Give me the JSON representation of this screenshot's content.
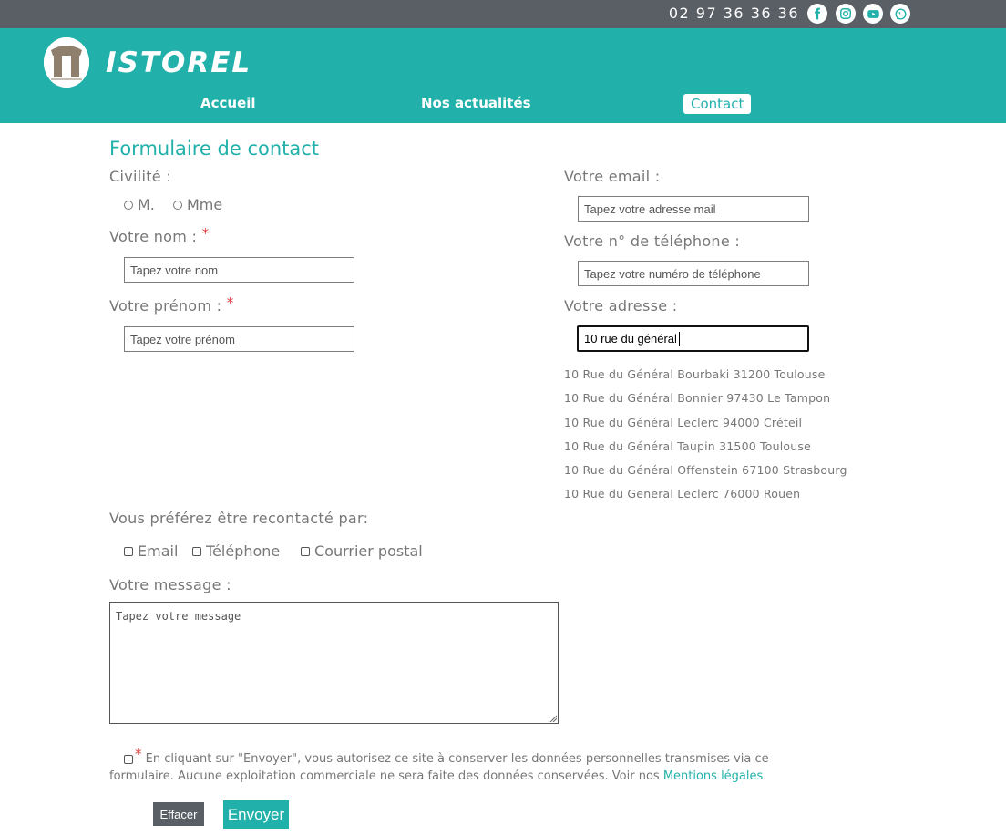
{
  "topbar": {
    "phone": "02 97 36 36 36",
    "social": [
      {
        "icon": "facebook-icon"
      },
      {
        "icon": "instagram-icon"
      },
      {
        "icon": "youtube-icon"
      },
      {
        "icon": "whatsapp-icon"
      }
    ]
  },
  "header": {
    "brand": "ISTOREL",
    "nav": [
      "Accueil",
      "Nos actualités",
      "Contact"
    ],
    "active_nav": "Contact"
  },
  "form": {
    "title": "Formulaire de contact",
    "civility": {
      "label": "Civilité :",
      "options": [
        "M.",
        "Mme"
      ]
    },
    "name": {
      "label": "Votre nom :",
      "required": "*",
      "placeholder": "Tapez votre nom"
    },
    "firstname": {
      "label": "Votre prénom :",
      "required": "*",
      "placeholder": "Tapez votre prénom"
    },
    "email": {
      "label": "Votre email :",
      "placeholder": "Tapez votre adresse mail"
    },
    "phone": {
      "label": "Votre n° de téléphone :",
      "placeholder": "Tapez votre numéro de téléphone"
    },
    "address": {
      "label": "Votre adresse :",
      "value": "10 rue du général",
      "suggestions": [
        "10 Rue du Général Bourbaki 31200 Toulouse",
        "10 Rue du Général Bonnier 97430 Le Tampon",
        "10 Rue du Général Leclerc 94000 Créteil",
        "10 Rue du Général Taupin 31500 Toulouse",
        "10 Rue du Général Offenstein 67100 Strasbourg",
        "10 Rue du General Leclerc 76000 Rouen"
      ]
    },
    "contact_pref": {
      "label": "Vous préférez être recontacté par:",
      "options": [
        "Email",
        "Téléphone",
        "Courrier postal"
      ]
    },
    "message": {
      "label": "Votre message :",
      "placeholder": "Tapez votre message"
    },
    "consent": {
      "required": "*",
      "text": "En cliquant sur \"Envoyer\", vous autorisez ce site à conserver les données personnelles transmises via ce formulaire. Aucune exploitation commerciale ne sera faite des données conservées. Voir nos ",
      "link": "Mentions légales",
      "end": "."
    },
    "buttons": {
      "clear": "Effacer",
      "send": "Envoyer"
    }
  },
  "colors": {
    "accent": "#22b1aa",
    "topbar": "#5a5f66",
    "required": "#e03a3a"
  }
}
